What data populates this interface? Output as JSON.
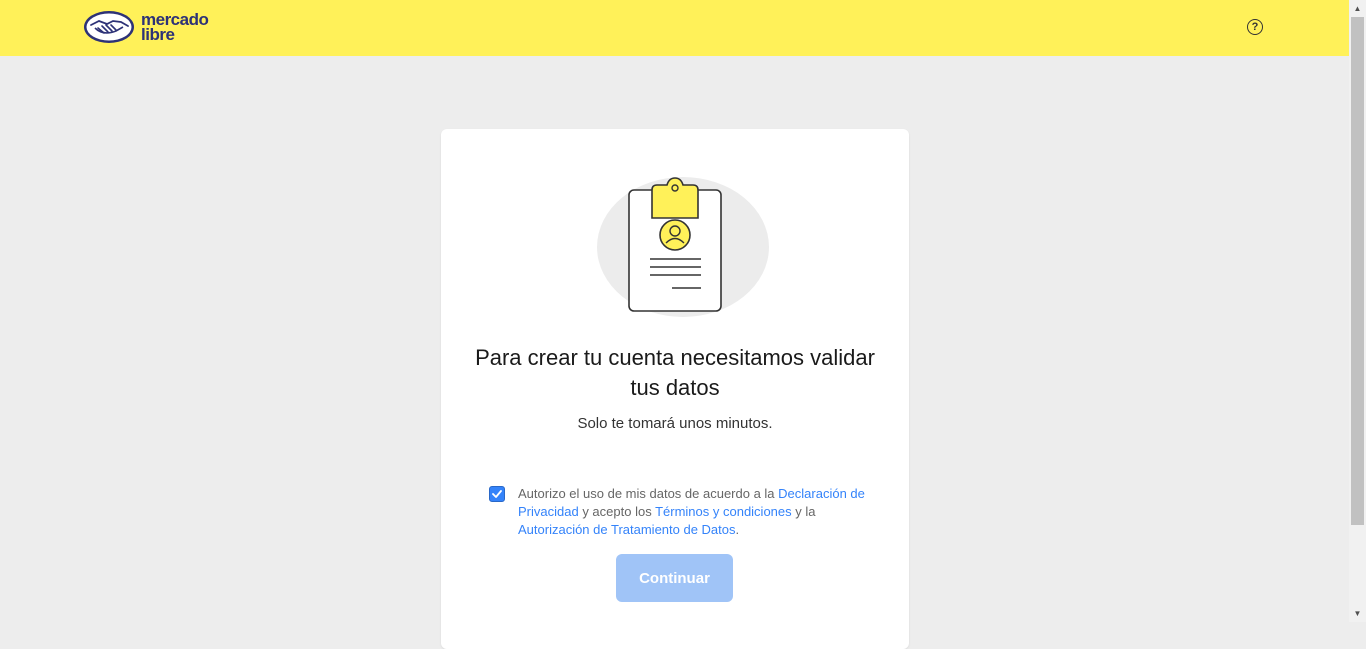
{
  "header": {
    "logo_line1": "mercado",
    "logo_line2": "libre",
    "help_symbol": "?",
    "background_color": "#fff159"
  },
  "card": {
    "title": "Para crear tu cuenta necesitamos validar tus datos",
    "subtitle": "Solo te tomará unos minutos.",
    "consent": {
      "checked": true,
      "text_1": "Autorizo el uso de mis datos de acuerdo a la ",
      "link_privacy": "Declaración de Privacidad",
      "text_2": " y acepto los ",
      "link_terms": "Términos y condiciones",
      "text_3": " y la ",
      "link_data_treatment": "Autorización de Tratamiento de Datos",
      "text_4": "."
    },
    "continue_label": "Continuar"
  },
  "colors": {
    "accent": "#3483fa",
    "button_disabled": "#a0c4f7",
    "brand_blue": "#2d3277",
    "background": "#ededed"
  },
  "icons": {
    "logo": "handshake-icon",
    "help": "question-circle-icon",
    "illustration": "clipboard-user-icon",
    "checkbox": "checkmark-icon"
  }
}
